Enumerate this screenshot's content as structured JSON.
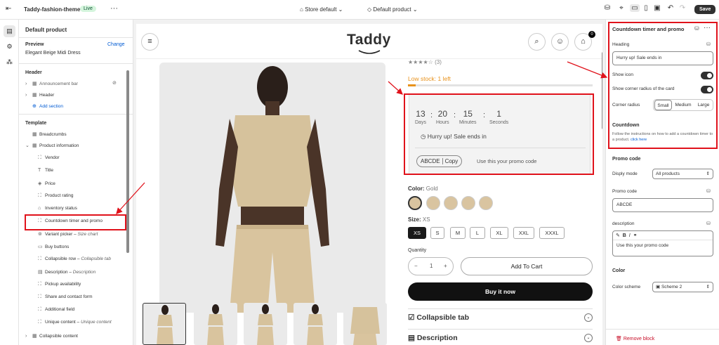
{
  "topbar": {
    "theme_name": "Taddy-fashion-theme",
    "live_badge": "Live",
    "store_selector": "Store default",
    "template_selector": "Default product",
    "save_label": "Save"
  },
  "sidebar": {
    "title": "Default product",
    "preview_label": "Preview",
    "change_label": "Change",
    "preview_product": "Elegant Beige Midi Dress",
    "header_section": "Header",
    "header_items": [
      "Announcement bar",
      "Header"
    ],
    "add_section": "Add section",
    "template_section": "Template",
    "breadcrumbs": "Breadcrumbs",
    "product_information": "Product information",
    "blocks": [
      {
        "label": "Vendor",
        "sub": ""
      },
      {
        "label": "Title",
        "sub": ""
      },
      {
        "label": "Price",
        "sub": ""
      },
      {
        "label": "Product rating",
        "sub": ""
      },
      {
        "label": "Inventory status",
        "sub": ""
      },
      {
        "label": "Countdown timer and promo",
        "sub": ""
      },
      {
        "label": "Variant picker",
        "sub": "Size chart"
      },
      {
        "label": "Buy buttons",
        "sub": ""
      },
      {
        "label": "Collapsible row",
        "sub": "Collapsible tab"
      },
      {
        "label": "Description",
        "sub": "Description"
      },
      {
        "label": "Pickup availability",
        "sub": ""
      },
      {
        "label": "Share and contact form",
        "sub": ""
      },
      {
        "label": "Additional field",
        "sub": ""
      },
      {
        "label": "Unique content",
        "sub": "Unique content"
      }
    ],
    "collapsible_content": "Collapsible content"
  },
  "storefront": {
    "logo": "Taddy",
    "cart_count": "0",
    "rating_count": "(3)",
    "low_stock": "Low stock: 1 left",
    "low_stock_fraction": 0.04,
    "countdown": {
      "units": [
        {
          "value": "13",
          "label": "Days"
        },
        {
          "value": "20",
          "label": "Hours"
        },
        {
          "value": "15",
          "label": "Minutes"
        },
        {
          "value": "1",
          "label": "Seconds"
        }
      ],
      "message": "Hurry up! Sale ends in",
      "promo_code": "ABCDE",
      "copy_label": "Copy",
      "promo_text": "Use this your promo code"
    },
    "color_label": "Color:",
    "color_value": "Gold",
    "size_label": "Size:",
    "size_value": "XS",
    "sizes": [
      "XS",
      "S",
      "M",
      "L",
      "XL",
      "XXL",
      "XXXL"
    ],
    "quantity_label": "Quantity",
    "quantity_minus": "−",
    "quantity_value": "1",
    "quantity_plus": "+",
    "add_to_cart": "Add To Cart",
    "buy_now": "Buy it now",
    "collapsible_tab": "Collapsible tab",
    "description_tab": "Description"
  },
  "settings": {
    "title": "Countdown timer and promo",
    "heading_label": "Heading",
    "heading_value": "Hurry up! Sale ends in",
    "show_icon": "Show icon",
    "show_corner_radius": "Show corner radius of the card",
    "corner_radius_label": "Corner radius",
    "corner_options": [
      "Small",
      "Medium",
      "Large"
    ],
    "countdown_heading": "Countdown",
    "countdown_help": "Follow the instructions on how to add a countdown timer to a product.",
    "click_here": "click here",
    "promo_heading": "Promo code",
    "display_mode_label": "Disply mode",
    "display_mode_value": "All products",
    "promo_code_label": "Promo code",
    "promo_code_value": "ABCDE",
    "description_label": "description",
    "description_value": "Use this your promo code",
    "color_heading": "Color",
    "color_scheme_label": "Color scheme",
    "color_scheme_value": "Scheme 2",
    "remove_block": "Remove block"
  },
  "colors": {
    "accent_red": "#e0121b",
    "link_blue": "#005bd3",
    "low_stock": "#e8921c",
    "live_green": "#d5f5dd"
  }
}
